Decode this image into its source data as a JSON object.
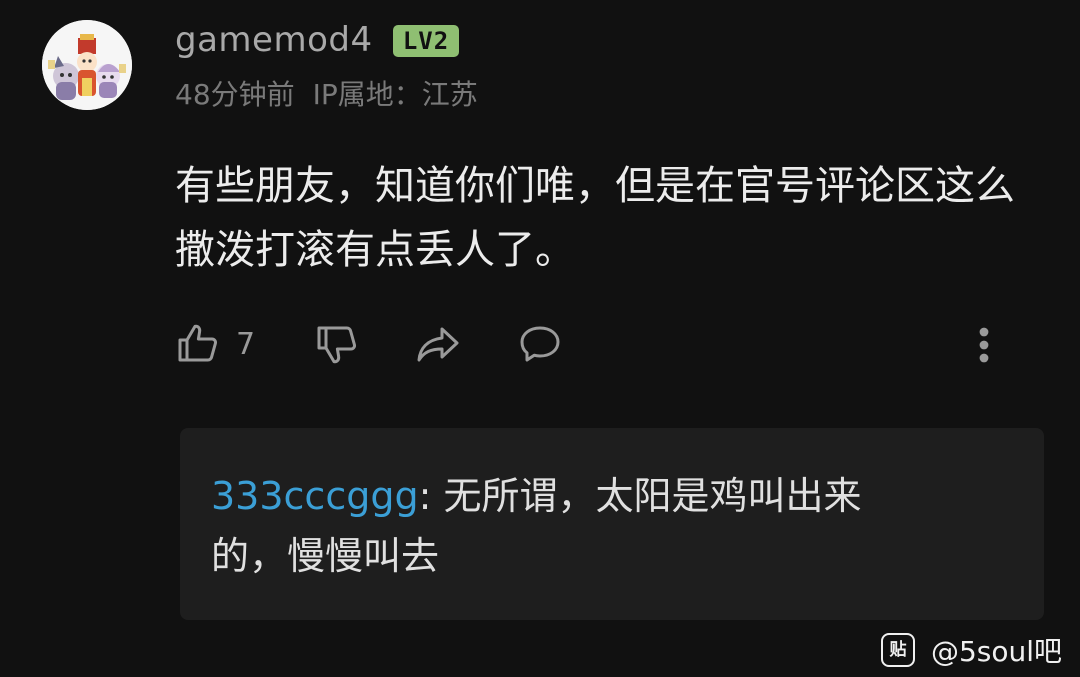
{
  "comment": {
    "username": "gamemod4",
    "level_badge": "LV2",
    "time": "48分钟前",
    "ip_location": "IP属地：江苏",
    "text": "有些朋友，知道你们唯，但是在官号评论区这么撒泼打滚有点丢人了。",
    "like_count": "7"
  },
  "actions": {
    "icons": [
      "thumbs-up-icon",
      "thumbs-down-icon",
      "share-icon",
      "comment-icon",
      "more-vertical-icon"
    ]
  },
  "reply": {
    "username": "333cccggg",
    "separator": ": ",
    "text": "无所谓，太阳是鸡叫出来的，慢慢叫去"
  },
  "watermark": {
    "logo_text": "贴",
    "text": "@5soul吧"
  },
  "colors": {
    "background": "#111111",
    "reply_background": "#1e1e1e",
    "reply_username": "#3b9fd6",
    "level_badge": "#8fbf72"
  }
}
